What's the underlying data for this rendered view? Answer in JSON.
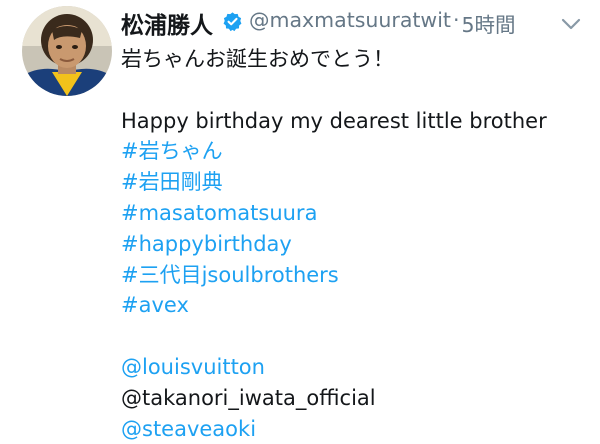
{
  "tweet": {
    "display_name": "松浦勝人",
    "handle": "@maxmatsuuratwit",
    "separator": "·",
    "time": "5時間",
    "lines": [
      {
        "text": "岩ちゃんお誕生おめでとう！",
        "kind": "plain"
      },
      {
        "text": "",
        "kind": "blank"
      },
      {
        "text": "Happy birthday my dearest little brother",
        "kind": "plain"
      },
      {
        "text": "#岩ちゃん",
        "kind": "link"
      },
      {
        "text": "#岩田剛典",
        "kind": "link"
      },
      {
        "text": "#masatomatsuura",
        "kind": "link"
      },
      {
        "text": "#happybirthday",
        "kind": "link"
      },
      {
        "text": "#三代目jsoulbrothers",
        "kind": "link"
      },
      {
        "text": "#avex",
        "kind": "link"
      },
      {
        "text": "",
        "kind": "blank"
      },
      {
        "text": "@louisvuitton",
        "kind": "link"
      },
      {
        "text": "@takanori_iwata_official",
        "kind": "plain"
      },
      {
        "text": "@steaveaoki",
        "kind": "link"
      }
    ]
  },
  "colors": {
    "link": "#1da1f2",
    "text": "#14171a",
    "muted": "#657786",
    "verified": "#1da1f2"
  },
  "icons": {
    "verified": "verified-badge-icon",
    "chevron": "chevron-down-icon"
  }
}
